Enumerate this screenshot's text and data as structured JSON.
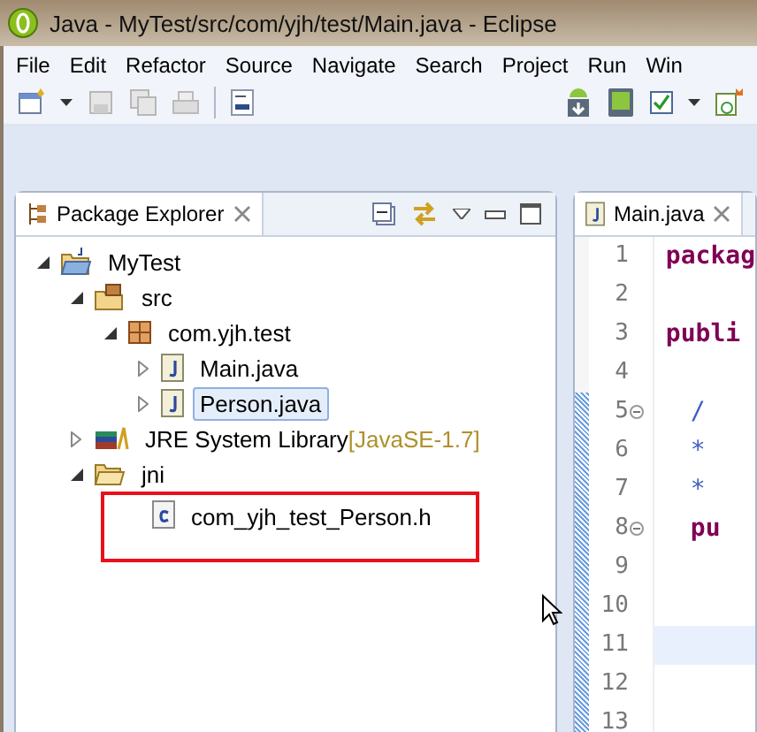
{
  "window": {
    "title": "Java - MyTest/src/com/yjh/test/Main.java - Eclipse"
  },
  "menu": [
    "File",
    "Edit",
    "Refactor",
    "Source",
    "Navigate",
    "Search",
    "Project",
    "Run",
    "Win"
  ],
  "package_explorer": {
    "tab": "Package Explorer",
    "tree": [
      {
        "label": "MyTest",
        "kind": "project",
        "expanded": true,
        "selected": false,
        "children": [
          {
            "label": "src",
            "kind": "source-folder",
            "expanded": true,
            "selected": false,
            "children": [
              {
                "label": "com.yjh.test",
                "kind": "package",
                "expanded": true,
                "selected": false,
                "children": [
                  {
                    "label": "Main.java",
                    "kind": "java-file",
                    "expanded": false,
                    "selected": false
                  },
                  {
                    "label": "Person.java",
                    "kind": "java-file",
                    "expanded": false,
                    "selected": true
                  }
                ]
              }
            ]
          },
          {
            "label": "JRE System Library",
            "decoration": "[JavaSE-1.7]",
            "kind": "library",
            "expanded": false,
            "selected": false
          },
          {
            "label": "jni",
            "kind": "folder",
            "expanded": true,
            "selected": false,
            "children": [
              {
                "label": "com_yjh_test_Person.h",
                "kind": "c-file",
                "selected": false,
                "highlighted": true
              }
            ]
          }
        ]
      }
    ]
  },
  "editor": {
    "tab": "Main.java",
    "lines": [
      {
        "number": "1",
        "code": "packag",
        "kind": "keyword",
        "current": false,
        "foldable": false
      },
      {
        "number": "2",
        "current": false,
        "foldable": false
      },
      {
        "number": "3",
        "code": "publi",
        "kind": "keyword",
        "current": false,
        "foldable": false
      },
      {
        "number": "4",
        "current": false,
        "foldable": false
      },
      {
        "number": "5",
        "code": "/",
        "kind": "comment",
        "indent": true,
        "current": false,
        "foldable": true
      },
      {
        "number": "6",
        "code": "*",
        "kind": "comment",
        "indent": true,
        "current": false,
        "foldable": false
      },
      {
        "number": "7",
        "code": "*",
        "kind": "comment",
        "indent": true,
        "current": false,
        "foldable": false
      },
      {
        "number": "8",
        "code": "pu",
        "kind": "keyword",
        "indent": true,
        "current": false,
        "foldable": true
      },
      {
        "number": "9",
        "current": false,
        "foldable": false
      },
      {
        "number": "10",
        "current": false,
        "foldable": false
      },
      {
        "number": "11",
        "current": true,
        "foldable": false
      },
      {
        "number": "12",
        "current": false,
        "foldable": false
      },
      {
        "number": "13",
        "current": false,
        "foldable": false
      }
    ]
  }
}
